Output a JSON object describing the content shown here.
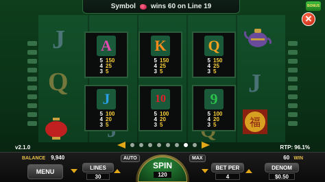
{
  "banner": {
    "prefix": "Symbol",
    "message": "wins 60 on Line 19"
  },
  "brand": {
    "logo_text": "BONUS"
  },
  "close": {
    "glyph": "✕"
  },
  "bg_symbols": [
    "J",
    "Q",
    "J",
    "Q",
    "J"
  ],
  "paytable": [
    {
      "symbol": "A",
      "color": "#e04bb0",
      "bg": "#1a5a3a",
      "rows": [
        {
          "count": "5",
          "pay": "150"
        },
        {
          "count": "4",
          "pay": "25"
        },
        {
          "count": "3",
          "pay": "5"
        }
      ]
    },
    {
      "symbol": "K",
      "color": "#ff8c1a",
      "bg": "#1a5a3a",
      "rows": [
        {
          "count": "5",
          "pay": "150"
        },
        {
          "count": "4",
          "pay": "25"
        },
        {
          "count": "3",
          "pay": "5"
        }
      ]
    },
    {
      "symbol": "Q",
      "color": "#f0a020",
      "bg": "#1a5a3a",
      "rows": [
        {
          "count": "5",
          "pay": "150"
        },
        {
          "count": "4",
          "pay": "25"
        },
        {
          "count": "3",
          "pay": "5"
        }
      ]
    },
    {
      "symbol": "J",
      "color": "#2aa0e8",
      "bg": "#1a5a3a",
      "rows": [
        {
          "count": "5",
          "pay": "100"
        },
        {
          "count": "4",
          "pay": "20"
        },
        {
          "count": "3",
          "pay": "5"
        }
      ]
    },
    {
      "symbol": "10",
      "color": "#e0202a",
      "bg": "#1a5a3a",
      "rows": [
        {
          "count": "5",
          "pay": "100"
        },
        {
          "count": "4",
          "pay": "20"
        },
        {
          "count": "3",
          "pay": "5"
        }
      ]
    },
    {
      "symbol": "9",
      "color": "#2ac04a",
      "bg": "#1a5a3a",
      "rows": [
        {
          "count": "5",
          "pay": "100"
        },
        {
          "count": "4",
          "pay": "20"
        },
        {
          "count": "3",
          "pay": "5"
        }
      ]
    }
  ],
  "pager": {
    "page_count": 8,
    "active_page": 7
  },
  "version": "v2.1.0",
  "rtp": "RTP: 96.1%",
  "balance": {
    "label": "BALANCE",
    "value": "9,940"
  },
  "win": {
    "value": "60",
    "label": "WIN"
  },
  "menu": {
    "label": "MENU"
  },
  "lines": {
    "label": "LINES",
    "value": "30"
  },
  "auto": {
    "label": "AUTO"
  },
  "spin": {
    "label": "SPIN",
    "total_bet": "120"
  },
  "max": {
    "label": "MAX"
  },
  "bet_per": {
    "label": "BET PER",
    "value": "4"
  },
  "denom": {
    "label": "DENOM",
    "value": "$0.50"
  },
  "colors": {
    "accent": "#e3a818",
    "felt": "#0e3e1c"
  }
}
